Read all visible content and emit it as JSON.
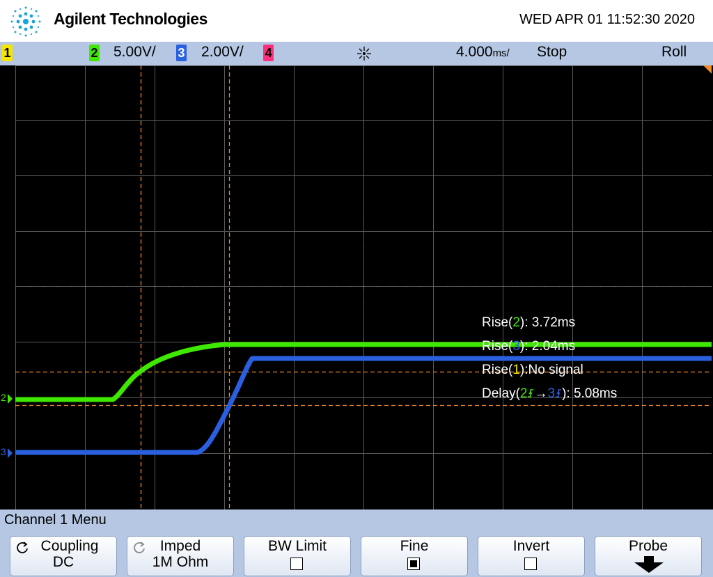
{
  "header": {
    "brand": "Agilent Technologies",
    "datetime": "WED APR 01 11:52:30 2020"
  },
  "status_bar": {
    "ch1_label": "1",
    "ch2_label": "2",
    "ch2_scale": "5.00V/",
    "ch3_label": "3",
    "ch3_scale": "2.00V/",
    "ch4_label": "4",
    "timebase": "4.000",
    "timebase_unit": "ms/",
    "run_state": "Stop",
    "mode": "Roll"
  },
  "colors": {
    "ch1": "#f5e500",
    "ch2": "#3ee800",
    "ch3": "#2a5fe0",
    "ch4": "#ff2f80",
    "grid": "#5a5a5a",
    "cursor": "#f08a2a"
  },
  "markers": {
    "ch2": "2",
    "ch3": "3"
  },
  "measurements": {
    "rise2_prefix": "Rise(",
    "rise2_ch": "2",
    "rise2_suffix": "): 3.72ms",
    "rise3_prefix": "Rise(",
    "rise3_ch": "3",
    "rise3_suffix": "): 2.04ms",
    "rise1_prefix": "Rise(",
    "rise1_ch": "1",
    "rise1_suffix": "):No signal",
    "delay_prefix": "Delay(",
    "delay_from": "2",
    "delay_arrow": "→",
    "delay_to": "3",
    "delay_suffix": "): 5.08ms"
  },
  "menu": {
    "title": "Channel 1  Menu",
    "softkeys": [
      {
        "label": "Coupling",
        "value": "DC"
      },
      {
        "label": "Imped",
        "value": "1M Ohm"
      },
      {
        "label": "BW Limit",
        "checked": false
      },
      {
        "label": "Fine",
        "checked": true
      },
      {
        "label": "Invert",
        "checked": false
      },
      {
        "label": "Probe"
      }
    ]
  }
}
